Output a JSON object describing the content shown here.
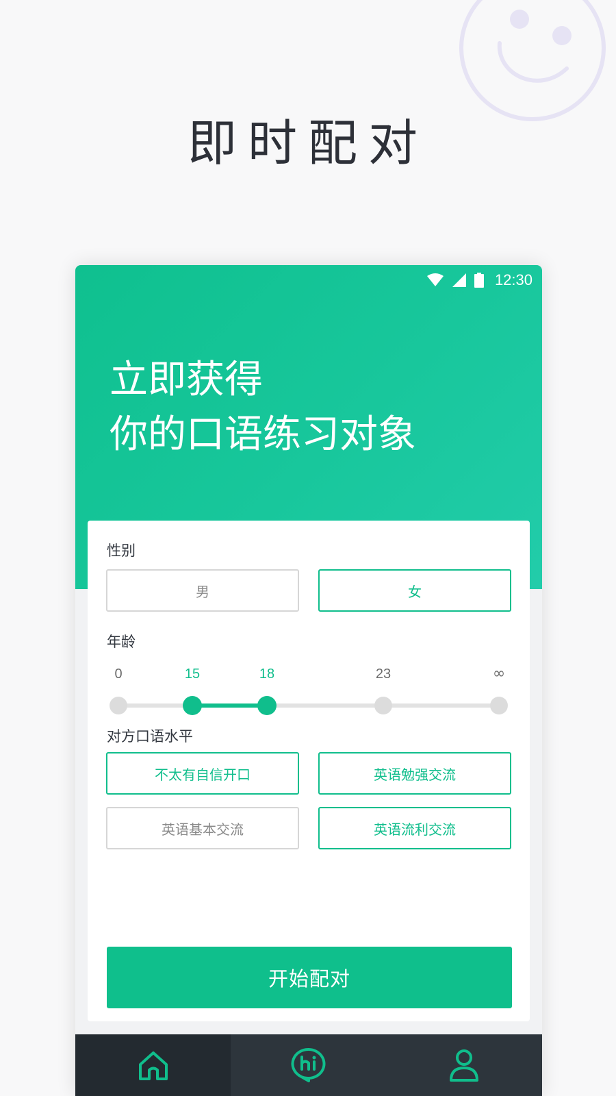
{
  "page": {
    "title": "即时配对"
  },
  "status_bar": {
    "time": "12:30"
  },
  "hero": {
    "line1": "立即获得",
    "line2": "你的口语练习对象"
  },
  "gender": {
    "label": "性别",
    "options": [
      {
        "label": "男",
        "selected": false
      },
      {
        "label": "女",
        "selected": true
      }
    ]
  },
  "age": {
    "label": "年龄",
    "stops": [
      "0",
      "15",
      "18",
      "23",
      "∞"
    ],
    "selected_range": [
      "15",
      "18"
    ]
  },
  "level": {
    "label": "对方口语水平",
    "options": [
      {
        "label": "不太有自信开口",
        "selected": true
      },
      {
        "label": "英语勉强交流",
        "selected": true
      },
      {
        "label": "英语基本交流",
        "selected": false
      },
      {
        "label": "英语流利交流",
        "selected": true
      }
    ]
  },
  "start_button": {
    "label": "开始配对"
  },
  "tabs": [
    {
      "icon": "home-icon",
      "active": true
    },
    {
      "icon": "hi-chat-icon",
      "active": false
    },
    {
      "icon": "user-icon",
      "active": false
    }
  ],
  "colors": {
    "accent": "#10be8c",
    "tab_bar": "#2a3137",
    "title": "#2d3038"
  }
}
